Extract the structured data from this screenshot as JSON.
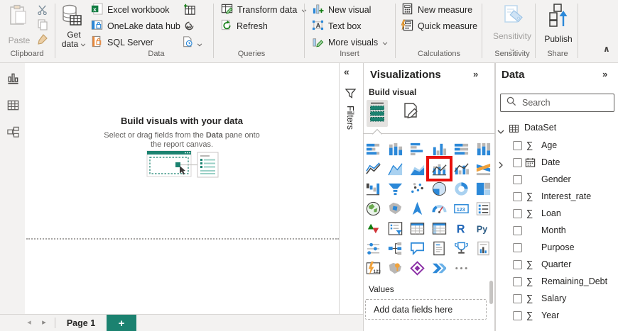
{
  "icons": {
    "sigma": "∑",
    "collapse_left": "«",
    "collapse_right": "»",
    "ribbon_collapse": "∧",
    "prev_page": "◂",
    "next_page": "▸",
    "ellipsis": "…"
  },
  "colors": {
    "accent_teal": "#1b8270",
    "highlight_red": "#e8100c",
    "icon_blue": "#2b88d8"
  },
  "ribbon": {
    "clipboard": {
      "group_label": "Clipboard",
      "paste": "Paste"
    },
    "data_group": {
      "group_label": "Data",
      "get_data_line1": "Get",
      "get_data_line2": "data",
      "items": [
        "Excel workbook",
        "OneLake data hub",
        "SQL Server"
      ]
    },
    "queries": {
      "group_label": "Queries",
      "items": [
        "Transform data",
        "Refresh"
      ]
    },
    "insert": {
      "group_label": "Insert",
      "items": [
        "New visual",
        "Text box",
        "More visuals"
      ]
    },
    "calculations": {
      "group_label": "Calculations",
      "items": [
        "New measure",
        "Quick measure"
      ]
    },
    "sensitivity": {
      "group_label": "Sensitivity",
      "button_label": "Sensitivity"
    },
    "share": {
      "group_label": "Share",
      "button_label": "Publish"
    }
  },
  "canvas": {
    "empty_state": {
      "title": "Build visuals with your data",
      "subtitle_prefix": "Select or drag fields from the ",
      "subtitle_bold": "Data",
      "subtitle_suffix": " pane onto",
      "subtitle_line2": "the report canvas."
    }
  },
  "filters_pane": {
    "title": "Filters"
  },
  "visualizations_pane": {
    "title": "Visualizations",
    "section_label": "Build visual",
    "values_label": "Values",
    "values_placeholder": "Add data fields here",
    "highlighted_visual": "line-and-stacked-column-chart",
    "gallery": [
      "stacked-bar-chart",
      "stacked-column-chart",
      "clustered-bar-chart",
      "clustered-column-chart",
      "100-stacked-bar-chart",
      "100-stacked-column-chart",
      "line-chart",
      "area-chart",
      "stacked-area-chart",
      "line-and-stacked-column-chart",
      "line-and-clustered-column-chart",
      "ribbon-chart",
      "waterfall-chart",
      "funnel-chart",
      "scatter-chart",
      "pie-chart",
      "donut-chart",
      "treemap",
      "map",
      "filled-map",
      "azure-map",
      "gauge",
      "card",
      "multi-row-card",
      "kpi",
      "slicer",
      "table",
      "matrix",
      "r-script-visual",
      "python-visual",
      "key-influencers",
      "decomposition-tree",
      "qa-visual",
      "smart-narrative",
      "metrics",
      "paginated-report",
      "lightning-123-visual",
      "arcgis-map-visual",
      "power-apps-visual",
      "power-automate-visual",
      "more-visual-options"
    ]
  },
  "data_pane": {
    "title": "Data",
    "search_placeholder": "Search",
    "table_name": "DataSet",
    "fields": [
      {
        "name": "Age",
        "type": "numeric"
      },
      {
        "name": "Date",
        "type": "date",
        "expandable": true
      },
      {
        "name": "Gender",
        "type": "text"
      },
      {
        "name": "Interest_rate",
        "type": "numeric"
      },
      {
        "name": "Loan",
        "type": "numeric"
      },
      {
        "name": "Month",
        "type": "text"
      },
      {
        "name": "Purpose",
        "type": "text"
      },
      {
        "name": "Quarter",
        "type": "numeric"
      },
      {
        "name": "Remaining_Debt",
        "type": "numeric"
      },
      {
        "name": "Salary",
        "type": "numeric"
      },
      {
        "name": "Year",
        "type": "numeric"
      }
    ]
  },
  "page_bar": {
    "page_label": "Page 1",
    "add_page": "+"
  }
}
